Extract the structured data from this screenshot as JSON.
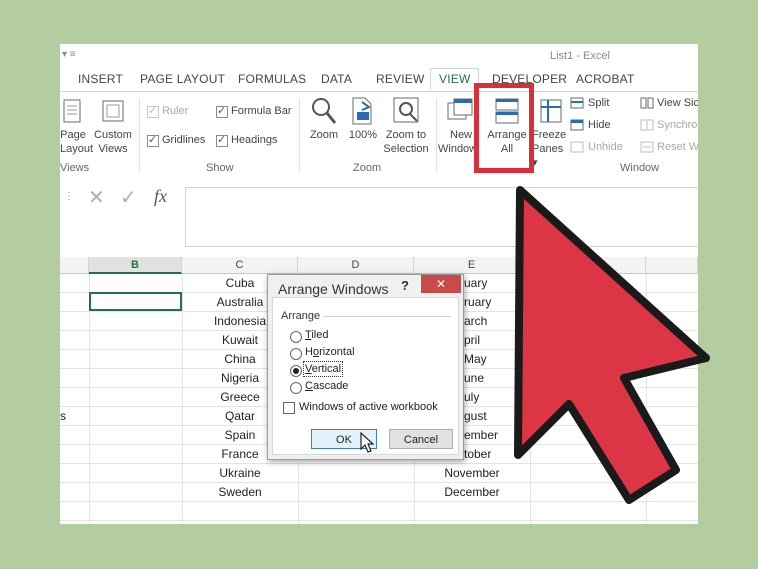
{
  "window": {
    "title": "List1 - Excel",
    "quick_access": "▾  ≡"
  },
  "tabs": [
    "INSERT",
    "PAGE LAYOUT",
    "FORMULAS",
    "DATA",
    "REVIEW",
    "VIEW",
    "DEVELOPER",
    "ACROBAT"
  ],
  "active_tab": "VIEW",
  "ribbon": {
    "workbook_views": {
      "page_layout": [
        "Page",
        "Layout"
      ],
      "custom_views": [
        "Custom",
        "Views"
      ],
      "group": "Views"
    },
    "show": {
      "ruler": "Ruler",
      "formula_bar": "Formula Bar",
      "gridlines": "Gridlines",
      "headings": "Headings",
      "group": "Show"
    },
    "zoom": {
      "zoom": "Zoom",
      "hundred": "100%",
      "zoom_to_selection": [
        "Zoom to",
        "Selection"
      ],
      "group": "Zoom"
    },
    "window": {
      "new_window": [
        "New",
        "Window"
      ],
      "arrange_all": [
        "Arrange",
        "All"
      ],
      "freeze_panes": [
        "Freeze",
        "Panes ▾"
      ],
      "split": "Split",
      "hide": "Hide",
      "unhide": "Unhide",
      "view_side": "View Sic",
      "synchronous": "Synchro",
      "reset_window": "Reset W",
      "group": "Window"
    }
  },
  "formula_bar": {
    "cancel": "✕",
    "enter": "✓",
    "fx": "fx"
  },
  "columns": [
    "B",
    "C",
    "D",
    "E"
  ],
  "selected_column": "B",
  "column_c_values": [
    "Cuba",
    "Australia",
    "Indonesia",
    "Kuwait",
    "China",
    "Nigeria",
    "Greece",
    "Qatar",
    "Spain",
    "France",
    "Ukraine",
    "Sweden"
  ],
  "column_e_values": [
    "uary",
    "ruary",
    "arch",
    "pril",
    "May",
    "une",
    "uly",
    "gust",
    "ember",
    "tober",
    "November",
    "December"
  ],
  "left_edge_text": "s",
  "dialog": {
    "title": "Arrange Windows",
    "help": "?",
    "close": "✕",
    "group_label": "Arrange",
    "options": [
      {
        "label": "Tiled",
        "underline_index": 0,
        "selected": false
      },
      {
        "label": "Horizontal",
        "underline_index": 1,
        "selected": false
      },
      {
        "label": "Vertical",
        "underline_index": 0,
        "selected": true
      },
      {
        "label": "Cascade",
        "underline_index": 0,
        "selected": false
      }
    ],
    "windows_of_active_workbook": "Windows of active workbook",
    "windows_of_active_workbook_checked": false,
    "ok": "OK",
    "cancel": "Cancel"
  },
  "colors": {
    "background": "#b3cda0",
    "excel_green": "#217346",
    "highlight_red": "#d8303b",
    "arrow_red": "#dc3545"
  }
}
